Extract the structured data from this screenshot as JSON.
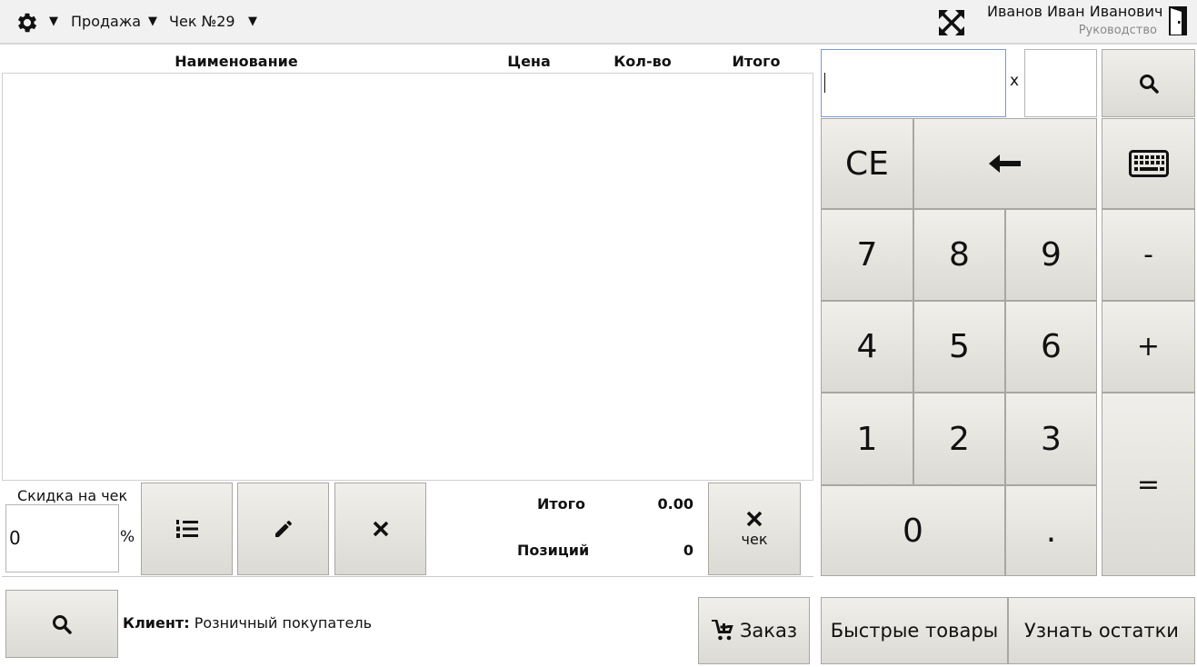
{
  "topbar": {
    "mode_label": "Продажа",
    "receipt_label": "Чек №29",
    "user_name": "Иванов Иван Иванович",
    "user_role": "Руководство"
  },
  "table": {
    "columns": [
      "Наименование",
      "Цена",
      "Кол-во",
      "Итого"
    ],
    "rows": []
  },
  "discount": {
    "label": "Скидка на чек",
    "value": "0",
    "unit": "%"
  },
  "summary": {
    "total_label": "Итого",
    "total_value": "0.00",
    "positions_label": "Позиций",
    "positions_value": "0"
  },
  "close_receipt": {
    "label": "чек"
  },
  "client": {
    "label": "Клиент:",
    "value": "Розничный покупатель"
  },
  "order_button": {
    "label": "Заказ"
  },
  "input": {
    "main_value": "",
    "multiply_sign": "x",
    "qty_value": ""
  },
  "keypad": {
    "ce": "CE",
    "k7": "7",
    "k8": "8",
    "k9": "9",
    "k4": "4",
    "k5": "5",
    "k6": "6",
    "k1": "1",
    "k2": "2",
    "k3": "3",
    "k0": "0",
    "dot": ".",
    "minus": "-",
    "plus": "+",
    "equals": "="
  },
  "bottom_buttons": {
    "quick_goods": "Быстрые товары",
    "check_stock": "Узнать остатки"
  }
}
